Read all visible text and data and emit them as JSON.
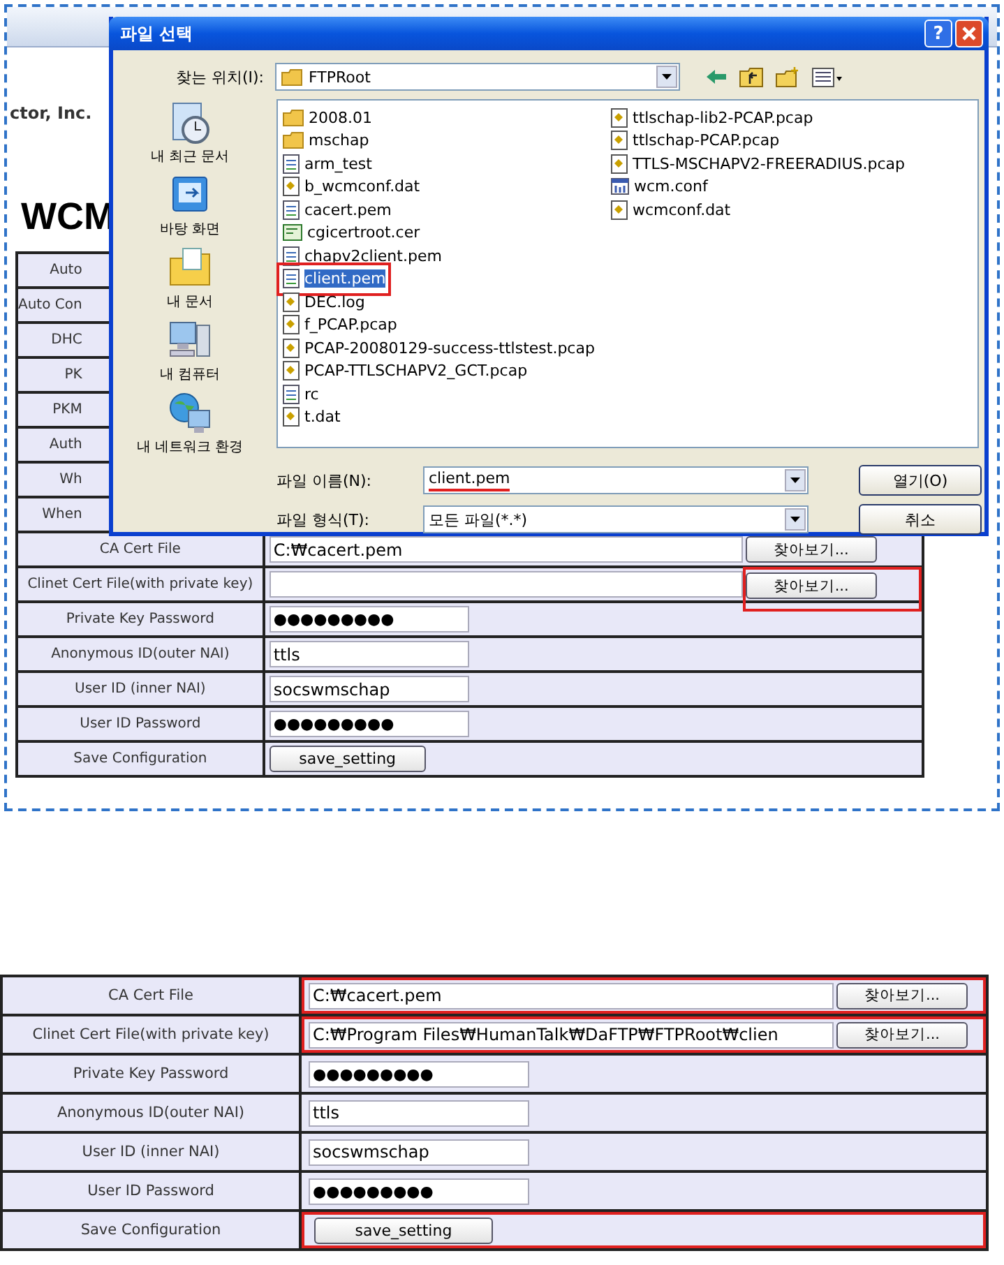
{
  "top_screenshot": {
    "page": {
      "company": "ctor, Inc.",
      "heading": "WCM",
      "table": {
        "rows": [
          {
            "kind": "covered",
            "label": "Auto"
          },
          {
            "kind": "covered",
            "label": "Auto Con"
          },
          {
            "kind": "covered",
            "label": "DHC"
          },
          {
            "kind": "covered",
            "label": "PK"
          },
          {
            "kind": "covered",
            "label": "PKM"
          },
          {
            "kind": "covered",
            "label": "Auth"
          },
          {
            "kind": "covered",
            "label": "Wh"
          },
          {
            "kind": "covered",
            "label": "When"
          },
          {
            "kind": "file",
            "label": "CA Cert File",
            "value": "C:₩cacert.pem",
            "button": "찾아보기...",
            "button_annotated": false,
            "value_annotated": false
          },
          {
            "kind": "file",
            "label": "Clinet Cert File(with private key)",
            "value": "",
            "button": "찾아보기...",
            "button_annotated": true,
            "value_annotated": false
          },
          {
            "kind": "password",
            "label": "Private Key Password",
            "value": "●●●●●●●●●"
          },
          {
            "kind": "text",
            "label": "Anonymous ID(outer NAI)",
            "value": "ttls"
          },
          {
            "kind": "text",
            "label": "User ID (inner NAI)",
            "value": "socswmschap"
          },
          {
            "kind": "password",
            "label": "User ID Password",
            "value": "●●●●●●●●●"
          },
          {
            "kind": "button",
            "label": "Save Configuration",
            "button": "save_setting",
            "value_annotated": false
          }
        ]
      }
    },
    "dialog": {
      "title": "파일 선택",
      "help_button": "?",
      "look_in": {
        "label": "찾는 위치(I):",
        "value": "FTPRoot"
      },
      "places": [
        "내 최근 문서",
        "바탕 화면",
        "내 문서",
        "내 컴퓨터",
        "내 네트워크 환경"
      ],
      "files": [
        {
          "name": "2008.01",
          "kind": "folder",
          "selected": false,
          "annotated": false
        },
        {
          "name": "mschap",
          "kind": "folder",
          "selected": false,
          "annotated": false
        },
        {
          "name": "arm_test",
          "kind": "document",
          "selected": false,
          "annotated": false
        },
        {
          "name": "b_wcmconf.dat",
          "kind": "data",
          "selected": false,
          "annotated": false
        },
        {
          "name": "cacert.pem",
          "kind": "document",
          "selected": false,
          "annotated": false
        },
        {
          "name": "cgicertroot.cer",
          "kind": "certificate",
          "selected": false,
          "annotated": false
        },
        {
          "name": "chapv2client.pem",
          "kind": "document",
          "selected": false,
          "annotated": false
        },
        {
          "name": "client.pem",
          "kind": "document",
          "selected": true,
          "annotated": true
        },
        {
          "name": "DEC.log",
          "kind": "data",
          "selected": false,
          "annotated": false
        },
        {
          "name": "f_PCAP.pcap",
          "kind": "data",
          "selected": false,
          "annotated": false
        },
        {
          "name": "PCAP-20080129-success-ttlstest.pcap",
          "kind": "data",
          "selected": false,
          "annotated": false
        },
        {
          "name": "PCAP-TTLSCHAPV2_GCT.pcap",
          "kind": "data",
          "selected": false,
          "annotated": false
        },
        {
          "name": "rc",
          "kind": "document",
          "selected": false,
          "annotated": false
        },
        {
          "name": "t.dat",
          "kind": "data",
          "selected": false,
          "annotated": false
        },
        {
          "name": "ttlschap-lib2-PCAP.pcap",
          "kind": "data",
          "selected": false,
          "annotated": false
        },
        {
          "name": "ttlschap-PCAP.pcap",
          "kind": "data",
          "selected": false,
          "annotated": false
        },
        {
          "name": "TTLS-MSCHAPV2-FREERADIUS.pcap",
          "kind": "data",
          "selected": false,
          "annotated": false
        },
        {
          "name": "wcm.conf",
          "kind": "config",
          "selected": false,
          "annotated": false
        },
        {
          "name": "wcmconf.dat",
          "kind": "data",
          "selected": false,
          "annotated": false
        }
      ],
      "file_name": {
        "label": "파일 이름(N):",
        "value": "client.pem",
        "underlined": true
      },
      "file_type": {
        "label": "파일 형식(T):",
        "value": "모든 파일(*.*)"
      },
      "buttons": [
        "열기(O)",
        "취소"
      ]
    }
  },
  "bottom_screenshot": {
    "table": {
      "rows": [
        {
          "kind": "file",
          "label": "CA Cert File",
          "value": "C:₩cacert.pem",
          "button": "찾아보기...",
          "button_annotated": false,
          "value_annotated": true
        },
        {
          "kind": "file",
          "label": "Clinet Cert File(with private key)",
          "value": "C:₩Program Files₩HumanTalk₩DaFTP₩FTPRoot₩clien",
          "button": "찾아보기...",
          "button_annotated": false,
          "value_annotated": true
        },
        {
          "kind": "password",
          "label": "Private Key Password",
          "value": "●●●●●●●●●"
        },
        {
          "kind": "text",
          "label": "Anonymous ID(outer NAI)",
          "value": "ttls"
        },
        {
          "kind": "text",
          "label": "User ID (inner NAI)",
          "value": "socswmschap"
        },
        {
          "kind": "password",
          "label": "User ID Password",
          "value": "●●●●●●●●●"
        },
        {
          "kind": "button",
          "label": "Save Configuration",
          "button": "save_setting",
          "value_annotated": true
        }
      ]
    }
  }
}
